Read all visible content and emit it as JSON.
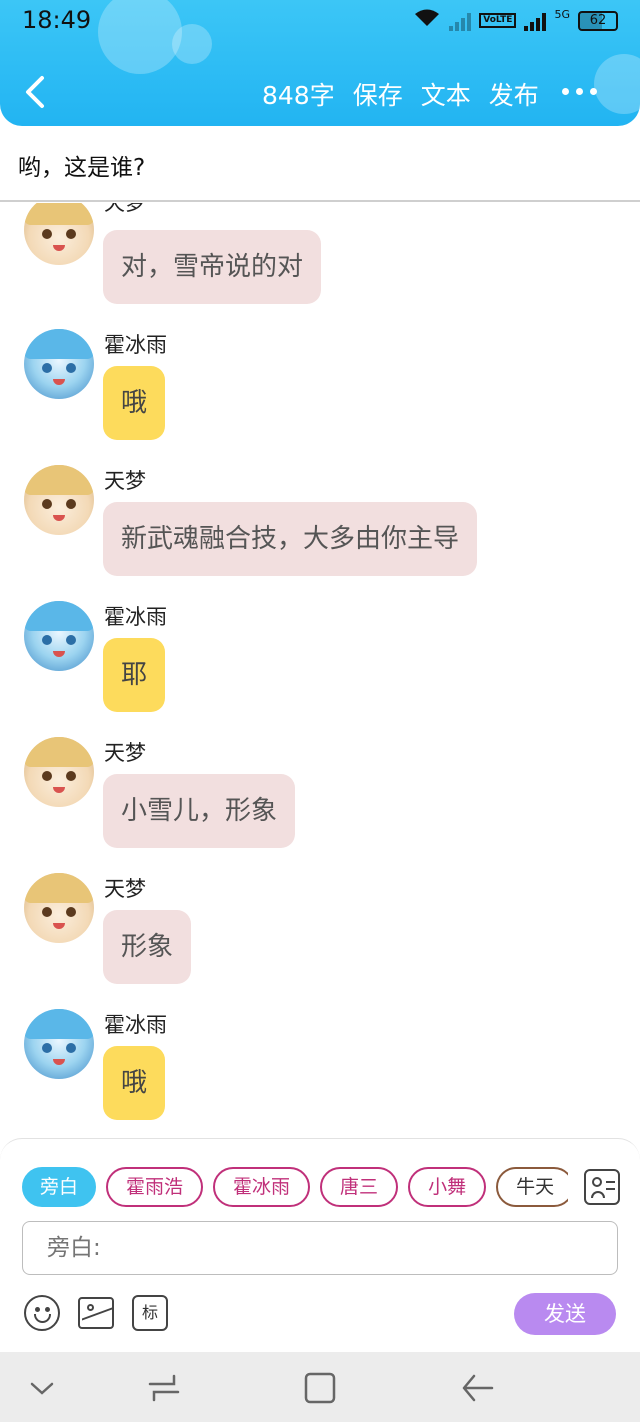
{
  "status_bar": {
    "time": "18:49",
    "network": "5G",
    "volte": "VoLTE",
    "battery": "62"
  },
  "header": {
    "word_count": "848字",
    "save_label": "保存",
    "text_label": "文本",
    "publish_label": "发布"
  },
  "title": "哟，这是谁?",
  "messages": [
    {
      "sender": "天梦",
      "text": "对，雪帝说的对",
      "style": "pink",
      "avatar": "tian"
    },
    {
      "sender": "霍冰雨",
      "text": "哦",
      "style": "yellow",
      "avatar": "huo"
    },
    {
      "sender": "天梦",
      "text": "新武魂融合技，大多由你主导",
      "style": "pink",
      "avatar": "tian"
    },
    {
      "sender": "霍冰雨",
      "text": "耶",
      "style": "yellow",
      "avatar": "huo"
    },
    {
      "sender": "天梦",
      "text": "小雪儿，形象",
      "style": "pink",
      "avatar": "tian"
    },
    {
      "sender": "天梦",
      "text": "形象",
      "style": "pink",
      "avatar": "tian"
    },
    {
      "sender": "霍冰雨",
      "text": "哦",
      "style": "yellow",
      "avatar": "huo"
    }
  ],
  "composer": {
    "roles": [
      "旁白",
      "霍雨浩",
      "霍冰雨",
      "唐三",
      "小舞",
      "牛天"
    ],
    "active_role": "旁白",
    "input_placeholder": "旁白:",
    "mark_label": "标",
    "send_label": "发送"
  },
  "colors": {
    "header": "#22b4f2",
    "pink_bubble": "#f2dfdf",
    "yellow_bubble": "#fddb5c",
    "send_button": "#b98af0",
    "active_chip": "#3fc3f0",
    "chip_border": "#c0307a"
  },
  "icons": {
    "back": "chevron-left-icon",
    "more": "more-horizontal-icon",
    "contacts": "contacts-icon",
    "emoji": "emoji-icon",
    "image": "image-icon",
    "nav": [
      "chevron-down-icon",
      "recent-apps-icon",
      "home-icon",
      "back-arrow-icon"
    ]
  }
}
